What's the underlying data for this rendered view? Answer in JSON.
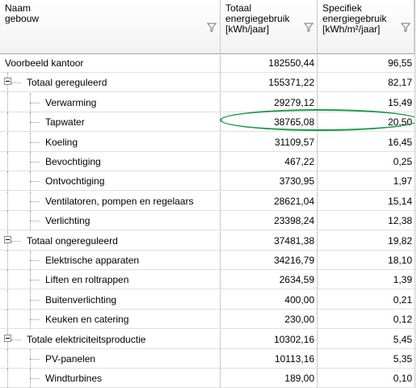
{
  "header": {
    "col_name": [
      "Naam",
      "gebouw"
    ],
    "col_total": [
      "Totaal",
      "energiegebruik",
      "[kWh/jaar]"
    ],
    "col_specific": [
      "Specifiek",
      "energiegebruik",
      "[kWh/m²/jaar]"
    ]
  },
  "rows": [
    {
      "level": 0,
      "name": "Voorbeeld kantoor",
      "total": "182550,44",
      "specific": "96,55"
    },
    {
      "level": 1,
      "expander": true,
      "name": "Totaal gereguleerd",
      "total": "155371,22",
      "specific": "82,17"
    },
    {
      "level": 2,
      "name": "Verwarming",
      "total": "29279,12",
      "specific": "15,49"
    },
    {
      "level": 2,
      "name": "Tapwater",
      "total": "38765,08",
      "specific": "20,50",
      "highlighted": true
    },
    {
      "level": 2,
      "name": "Koeling",
      "total": "31109,57",
      "specific": "16,45"
    },
    {
      "level": 2,
      "name": "Bevochtiging",
      "total": "467,22",
      "specific": "0,25"
    },
    {
      "level": 2,
      "name": "Ontvochtiging",
      "total": "3730,95",
      "specific": "1,97"
    },
    {
      "level": 2,
      "name": "Ventilatoren, pompen en regelaars",
      "total": "28621,04",
      "specific": "15,14"
    },
    {
      "level": 2,
      "name": "Verlichting",
      "total": "23398,24",
      "specific": "12,38"
    },
    {
      "level": 1,
      "expander": true,
      "name": "Totaal ongereguleerd",
      "total": "37481,38",
      "specific": "19,82"
    },
    {
      "level": 2,
      "name": "Elektrische apparaten",
      "total": "34216,79",
      "specific": "18,10"
    },
    {
      "level": 2,
      "name": "Liften en roltrappen",
      "total": "2634,59",
      "specific": "1,39"
    },
    {
      "level": 2,
      "name": "Buitenverlichting",
      "total": "400,00",
      "specific": "0,21"
    },
    {
      "level": 2,
      "name": "Keuken en catering",
      "total": "230,00",
      "specific": "0,12"
    },
    {
      "level": 1,
      "expander": true,
      "name": "Totale elektriciteitsproductie",
      "total": "10302,16",
      "specific": "5,45"
    },
    {
      "level": 2,
      "name": "PV-panelen",
      "total": "10113,16",
      "specific": "5,35"
    },
    {
      "level": 2,
      "name": "Windturbines",
      "total": "189,00",
      "specific": "0,10"
    }
  ],
  "colors": {
    "highlight_oval": "#1a9a4a",
    "grid_line": "#c8c8c8",
    "tree_line": "#9a9a9a"
  },
  "icons": {
    "filter": "filter-funnel-icon",
    "expander": "collapse-minus-icon"
  }
}
